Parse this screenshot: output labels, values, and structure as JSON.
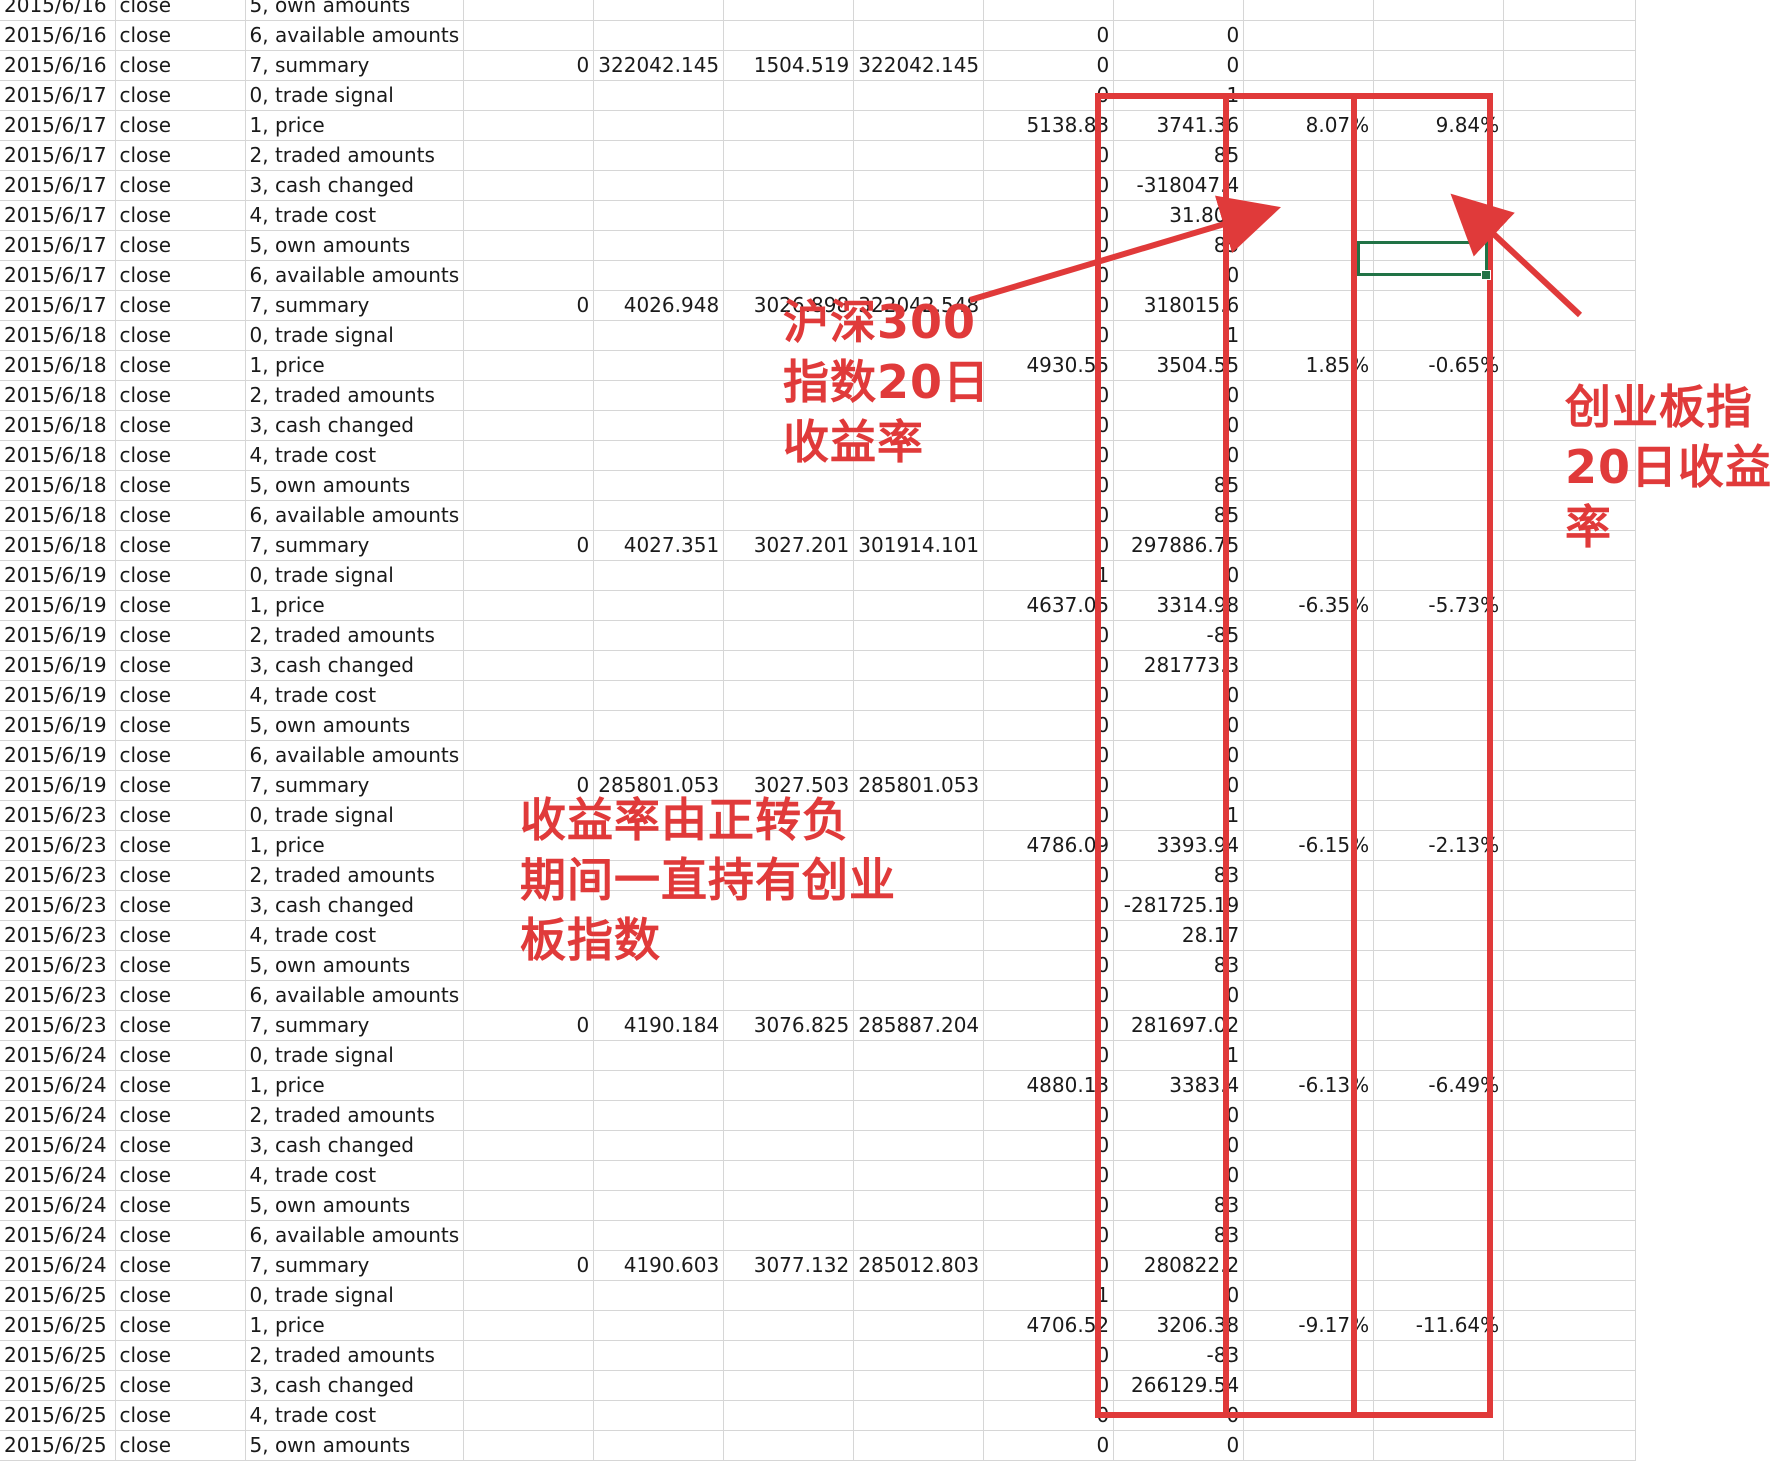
{
  "rows": [
    [
      "2015/6/16",
      "close",
      "5, own amounts",
      "",
      "",
      "",
      "",
      "",
      ""
    ],
    [
      "2015/6/16",
      "close",
      "6, available amounts",
      "",
      "",
      "",
      "",
      "0",
      "0",
      "",
      ""
    ],
    [
      "2015/6/16",
      "close",
      "7, summary",
      "0",
      "322042.145",
      "1504.519",
      "322042.145",
      "0",
      "0",
      "",
      ""
    ],
    [
      "2015/6/17",
      "close",
      "0, trade signal",
      "",
      "",
      "",
      "",
      "0",
      "1",
      "",
      ""
    ],
    [
      "2015/6/17",
      "close",
      "1, price",
      "",
      "",
      "",
      "",
      "5138.83",
      "3741.36",
      "8.07%",
      "9.84%"
    ],
    [
      "2015/6/17",
      "close",
      "2, traded amounts",
      "",
      "",
      "",
      "",
      "0",
      "85",
      "",
      ""
    ],
    [
      "2015/6/17",
      "close",
      "3, cash changed",
      "",
      "",
      "",
      "",
      "0",
      "-318047.4",
      "",
      ""
    ],
    [
      "2015/6/17",
      "close",
      "4, trade cost",
      "",
      "",
      "",
      "",
      "0",
      "31.802",
      "",
      ""
    ],
    [
      "2015/6/17",
      "close",
      "5, own amounts",
      "",
      "",
      "",
      "",
      "0",
      "85",
      "",
      ""
    ],
    [
      "2015/6/17",
      "close",
      "6, available amounts",
      "",
      "",
      "",
      "",
      "0",
      "0",
      "",
      ""
    ],
    [
      "2015/6/17",
      "close",
      "7, summary",
      "0",
      "4026.948",
      "3026.898",
      "322042.548",
      "0",
      "318015.6",
      "",
      ""
    ],
    [
      "2015/6/18",
      "close",
      "0, trade signal",
      "",
      "",
      "",
      "",
      "0",
      "1",
      "",
      ""
    ],
    [
      "2015/6/18",
      "close",
      "1, price",
      "",
      "",
      "",
      "",
      "4930.55",
      "3504.55",
      "1.85%",
      "-0.65%"
    ],
    [
      "2015/6/18",
      "close",
      "2, traded amounts",
      "",
      "",
      "",
      "",
      "0",
      "0",
      "",
      ""
    ],
    [
      "2015/6/18",
      "close",
      "3, cash changed",
      "",
      "",
      "",
      "",
      "0",
      "0",
      "",
      ""
    ],
    [
      "2015/6/18",
      "close",
      "4, trade cost",
      "",
      "",
      "",
      "",
      "0",
      "0",
      "",
      ""
    ],
    [
      "2015/6/18",
      "close",
      "5, own amounts",
      "",
      "",
      "",
      "",
      "0",
      "85",
      "",
      ""
    ],
    [
      "2015/6/18",
      "close",
      "6, available amounts",
      "",
      "",
      "",
      "",
      "0",
      "85",
      "",
      ""
    ],
    [
      "2015/6/18",
      "close",
      "7, summary",
      "0",
      "4027.351",
      "3027.201",
      "301914.101",
      "0",
      "297886.75",
      "",
      ""
    ],
    [
      "2015/6/19",
      "close",
      "0, trade signal",
      "",
      "",
      "",
      "",
      "1",
      "0",
      "",
      ""
    ],
    [
      "2015/6/19",
      "close",
      "1, price",
      "",
      "",
      "",
      "",
      "4637.05",
      "3314.98",
      "-6.35%",
      "-5.73%"
    ],
    [
      "2015/6/19",
      "close",
      "2, traded amounts",
      "",
      "",
      "",
      "",
      "0",
      "-85",
      "",
      ""
    ],
    [
      "2015/6/19",
      "close",
      "3, cash changed",
      "",
      "",
      "",
      "",
      "0",
      "281773.3",
      "",
      ""
    ],
    [
      "2015/6/19",
      "close",
      "4, trade cost",
      "",
      "",
      "",
      "",
      "0",
      "0",
      "",
      ""
    ],
    [
      "2015/6/19",
      "close",
      "5, own amounts",
      "",
      "",
      "",
      "",
      "0",
      "0",
      "",
      ""
    ],
    [
      "2015/6/19",
      "close",
      "6, available amounts",
      "",
      "",
      "",
      "",
      "0",
      "0",
      "",
      ""
    ],
    [
      "2015/6/19",
      "close",
      "7, summary",
      "0",
      "285801.053",
      "3027.503",
      "285801.053",
      "0",
      "0",
      "",
      ""
    ],
    [
      "2015/6/23",
      "close",
      "0, trade signal",
      "",
      "",
      "",
      "",
      "0",
      "1",
      "",
      ""
    ],
    [
      "2015/6/23",
      "close",
      "1, price",
      "",
      "",
      "",
      "",
      "4786.09",
      "3393.94",
      "-6.15%",
      "-2.13%"
    ],
    [
      "2015/6/23",
      "close",
      "2, traded amounts",
      "",
      "",
      "",
      "",
      "0",
      "83",
      "",
      ""
    ],
    [
      "2015/6/23",
      "close",
      "3, cash changed",
      "",
      "",
      "",
      "",
      "0",
      "-281725.19",
      "",
      ""
    ],
    [
      "2015/6/23",
      "close",
      "4, trade cost",
      "",
      "",
      "",
      "",
      "0",
      "28.17",
      "",
      ""
    ],
    [
      "2015/6/23",
      "close",
      "5, own amounts",
      "",
      "",
      "",
      "",
      "0",
      "83",
      "",
      ""
    ],
    [
      "2015/6/23",
      "close",
      "6, available amounts",
      "",
      "",
      "",
      "",
      "0",
      "0",
      "",
      ""
    ],
    [
      "2015/6/23",
      "close",
      "7, summary",
      "0",
      "4190.184",
      "3076.825",
      "285887.204",
      "0",
      "281697.02",
      "",
      ""
    ],
    [
      "2015/6/24",
      "close",
      "0, trade signal",
      "",
      "",
      "",
      "",
      "0",
      "1",
      "",
      ""
    ],
    [
      "2015/6/24",
      "close",
      "1, price",
      "",
      "",
      "",
      "",
      "4880.13",
      "3383.4",
      "-6.13%",
      "-6.49%"
    ],
    [
      "2015/6/24",
      "close",
      "2, traded amounts",
      "",
      "",
      "",
      "",
      "0",
      "0",
      "",
      ""
    ],
    [
      "2015/6/24",
      "close",
      "3, cash changed",
      "",
      "",
      "",
      "",
      "0",
      "0",
      "",
      ""
    ],
    [
      "2015/6/24",
      "close",
      "4, trade cost",
      "",
      "",
      "",
      "",
      "0",
      "0",
      "",
      ""
    ],
    [
      "2015/6/24",
      "close",
      "5, own amounts",
      "",
      "",
      "",
      "",
      "0",
      "83",
      "",
      ""
    ],
    [
      "2015/6/24",
      "close",
      "6, available amounts",
      "",
      "",
      "",
      "",
      "0",
      "83",
      "",
      ""
    ],
    [
      "2015/6/24",
      "close",
      "7, summary",
      "0",
      "4190.603",
      "3077.132",
      "285012.803",
      "0",
      "280822.2",
      "",
      ""
    ],
    [
      "2015/6/25",
      "close",
      "0, trade signal",
      "",
      "",
      "",
      "",
      "1",
      "0",
      "",
      ""
    ],
    [
      "2015/6/25",
      "close",
      "1, price",
      "",
      "",
      "",
      "",
      "4706.52",
      "3206.38",
      "-9.17%",
      "-11.64%"
    ],
    [
      "2015/6/25",
      "close",
      "2, traded amounts",
      "",
      "",
      "",
      "",
      "0",
      "-83",
      "",
      ""
    ],
    [
      "2015/6/25",
      "close",
      "3, cash changed",
      "",
      "",
      "",
      "",
      "0",
      "266129.54",
      "",
      ""
    ],
    [
      "2015/6/25",
      "close",
      "4, trade cost",
      "",
      "",
      "",
      "",
      "0",
      "0",
      "",
      ""
    ],
    [
      "2015/6/25",
      "close",
      "5, own amounts",
      "",
      "",
      "",
      "",
      "0",
      "0",
      "",
      ""
    ]
  ],
  "annotations": {
    "hs300": "沪深300\n指数20日\n收益率",
    "cyb": "创业板指\n20日收益\n率",
    "note": "收益率由正转负\n期间一直持有创业\n板指数"
  },
  "colors": {
    "annotation": "#e03a3a",
    "selection": "#217346",
    "gridline": "#d6d6d6"
  }
}
